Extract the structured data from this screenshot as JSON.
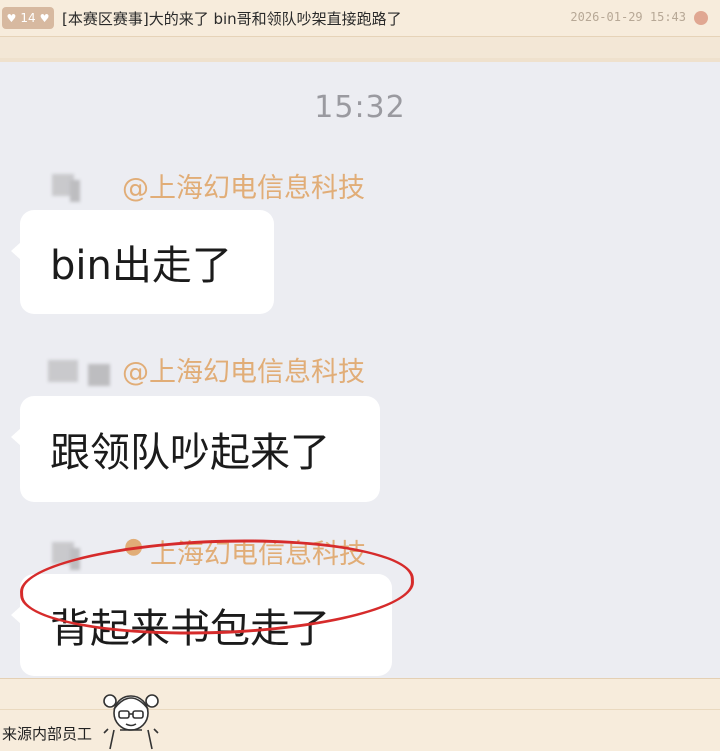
{
  "thread": {
    "reply_count": "14",
    "title": "[本赛区赛事]大的来了 bin哥和领队吵架直接跑路了",
    "date": "2026-01-29 15:43"
  },
  "chat": {
    "time": "15:32",
    "messages": [
      {
        "sender": "@上海幻电信息科技",
        "text": "bin出走了"
      },
      {
        "sender": "@上海幻电信息科技",
        "text": "跟领队吵起来了"
      },
      {
        "sender": "上海幻电信息科技",
        "text": "背起来书包走了"
      }
    ]
  },
  "footer": {
    "source_text": "来源内部员工"
  },
  "colors": {
    "sender": "#e1ad77",
    "highlight": "#d62b2b",
    "page_bg": "#f3e7d6"
  }
}
